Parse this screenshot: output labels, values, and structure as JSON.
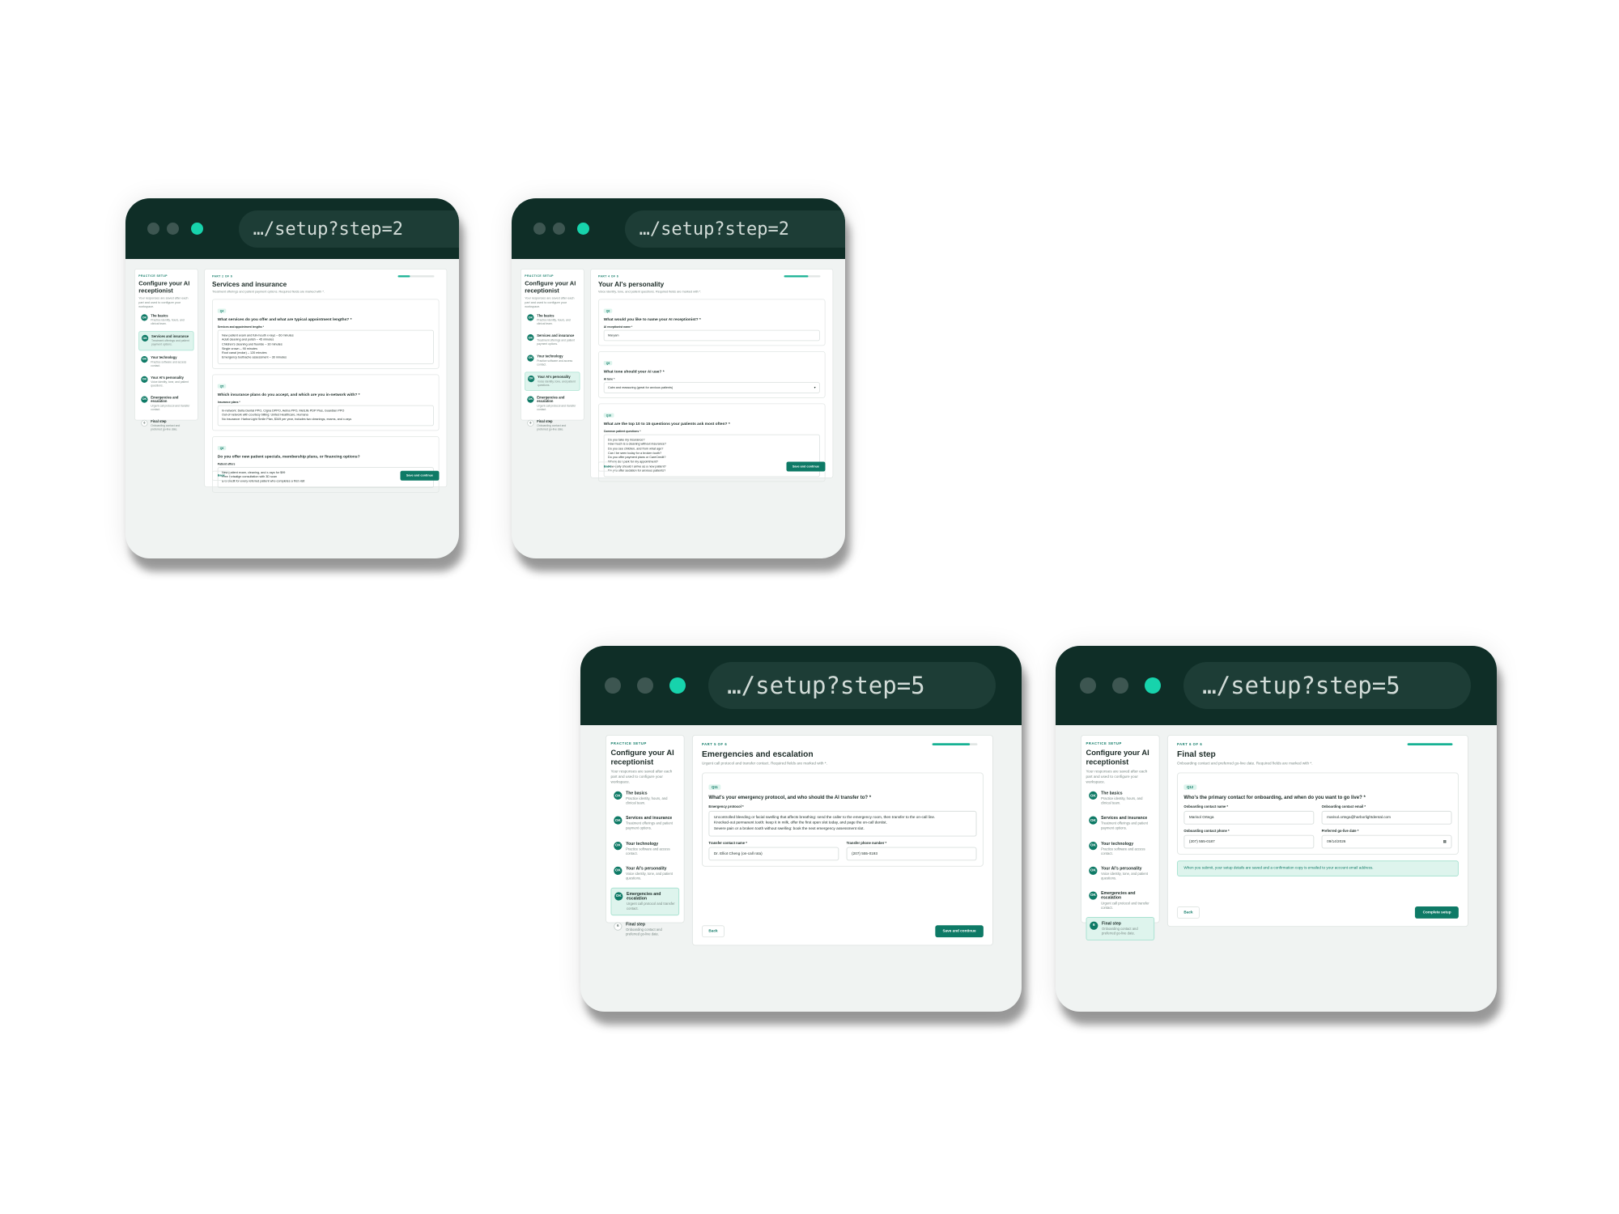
{
  "windows": [
    {
      "url": "…/setup?step=2",
      "sidebar_active": 1,
      "part": "PART 2 OF 6",
      "title": "Services and insurance",
      "subtitle": "Treatment offerings and patient payment options. Required fields are marked with *.",
      "progress": 0.33,
      "cta": "Save and continue",
      "questions": [
        {
          "badge": "Q4",
          "text": "What services do you offer and what are typical appointment lengths? *",
          "fields": [
            {
              "label": "Services and appointment lengths *",
              "type": "textarea",
              "value": "New patient exam and full-mouth x-rays – 60 minutes\nAdult cleaning and polish – 45 minutes\nChildren's cleaning and fluoride – 30 minutes\nSingle crown – 90 minutes\nRoot canal (molar) – 120 minutes\nEmergency toothache assessment – 30 minutes"
            }
          ]
        },
        {
          "badge": "Q5",
          "text": "Which insurance plans do you accept, and which are you in-network with? *",
          "fields": [
            {
              "label": "Insurance plans *",
              "type": "textarea",
              "value": "In-network: Delta Dental PPO, Cigna DPPO, Aetna PPO, MetLife PDP Plus, Guardian PPO\nOut-of-network with courtesy billing: United Healthcare, Humana\nNo insurance: HarborLight Smile Plan, $349 per year, includes two cleanings, exams, and x-rays"
            }
          ]
        },
        {
          "badge": "Q6",
          "text": "Do you offer new patient specials, membership plans, or financing options?",
          "fields": [
            {
              "label": "Patient offers",
              "type": "textarea",
              "value": "New patient exam, cleaning, and x-rays for $99\nFree Invisalign consultation with 3D scan\n$75 credit for every referred patient who completes a first visit"
            }
          ]
        }
      ]
    },
    {
      "url": "…/setup?step=2",
      "sidebar_active": 3,
      "part": "PART 4 OF 6",
      "title": "Your AI's personality",
      "subtitle": "Voice identity, tone, and patient questions. Required fields are marked with *.",
      "progress": 0.66,
      "cta": "Save and continue",
      "questions": [
        {
          "badge": "Q8",
          "text": "What would you like to name your AI receptionist? *",
          "fields": [
            {
              "label": "AI receptionist name *",
              "type": "input",
              "value": "Maryam"
            }
          ]
        },
        {
          "badge": "Q9",
          "text": "What tone should your AI use? *",
          "fields": [
            {
              "label": "AI tone *",
              "type": "select",
              "value": "Calm and reassuring (great for anxious patients)"
            }
          ]
        },
        {
          "badge": "Q10",
          "text": "What are the top 10 to 15 questions your patients ask most often? *",
          "fields": [
            {
              "label": "Common patient questions *",
              "type": "textarea",
              "value": "Do you take my insurance?\nHow much is a cleaning without insurance?\nDo you see children, and from what age?\nCan I be seen today for a broken tooth?\nDo you offer payment plans or CareCredit?\nWhere do I park for my appointment?\nHow early should I arrive as a new patient?\nDo you offer sedation for anxious patients?"
            }
          ]
        }
      ]
    },
    {
      "url": "…/setup?step=5",
      "sidebar_active": 4,
      "part": "PART 5 OF 6",
      "title": "Emergencies and escalation",
      "subtitle": "Urgent call protocol and transfer contact. Required fields are marked with *.",
      "progress": 0.83,
      "cta": "Save and continue",
      "questions": [
        {
          "badge": "Q11",
          "text": "What's your emergency protocol, and who should the AI transfer to? *",
          "fields": [
            {
              "label": "Emergency protocol *",
              "type": "textarea",
              "value": "Uncontrolled bleeding or facial swelling that affects breathing: send the caller to the emergency room, then transfer to the on-call line.\nKnocked-out permanent tooth: keep it in milk, offer the first open slot today, and page the on-call dentist.\nSevere pain or a broken tooth without swelling: book the next emergency assessment slot."
            },
            {
              "row": [
                {
                  "label": "Transfer contact name *",
                  "type": "input",
                  "value": "Dr. Elliot Cheng (on-call rota)"
                },
                {
                  "label": "Transfer phone number *",
                  "type": "input",
                  "value": "(207) 555-0193"
                }
              ]
            }
          ]
        }
      ]
    },
    {
      "url": "…/setup?step=5",
      "sidebar_active": 5,
      "part": "PART 6 OF 6",
      "title": "Final step",
      "subtitle": "Onboarding contact and preferred go-live date. Required fields are marked with *.",
      "progress": 1.0,
      "cta": "Complete setup",
      "notice": "When you submit, your setup details are saved and a confirmation copy is emailed to your account email address.",
      "questions": [
        {
          "badge": "Q12",
          "text": "Who's the primary contact for onboarding, and when do you want to go live? *",
          "fields": [
            {
              "row": [
                {
                  "label": "Onboarding contact name *",
                  "type": "input",
                  "value": "Marisol Ortega"
                },
                {
                  "label": "Onboarding contact email *",
                  "type": "input",
                  "value": "marisol.ortega@harborlightdental.com"
                }
              ]
            },
            {
              "row": [
                {
                  "label": "Onboarding contact phone *",
                  "type": "input",
                  "value": "(207) 555-0187"
                },
                {
                  "label": "Preferred go-live date *",
                  "type": "date",
                  "value": "09/14/2026"
                }
              ]
            }
          ]
        }
      ]
    }
  ],
  "sidebar": {
    "eyebrow": "PRACTICE SETUP",
    "title": "Configure your AI receptionist",
    "description": "Your responses are saved after each part and used to configure your workspace.",
    "steps": [
      {
        "badge": "OK",
        "title": "The basics",
        "desc": "Practice identity, hours, and clinical team."
      },
      {
        "badge": "OK",
        "title": "Services and insurance",
        "desc": "Treatment offerings and patient payment options."
      },
      {
        "badge": "OK",
        "title": "Your technology",
        "desc": "Practice software and access contact."
      },
      {
        "badge": "OK",
        "title": "Your AI's personality",
        "desc": "Voice identity, tone, and patient questions."
      },
      {
        "badge": "OK",
        "title": "Emergencies and escalation",
        "desc": "Urgent call protocol and transfer contact."
      },
      {
        "badge": "6",
        "title": "Final step",
        "desc": "Onboarding contact and preferred go-live date."
      }
    ]
  },
  "back_label": "Back",
  "colors": {
    "chrome": "#0f2e27",
    "accent": "#0e7a66",
    "active_dot": "#17d3ac",
    "highlight": "#def4ed"
  }
}
